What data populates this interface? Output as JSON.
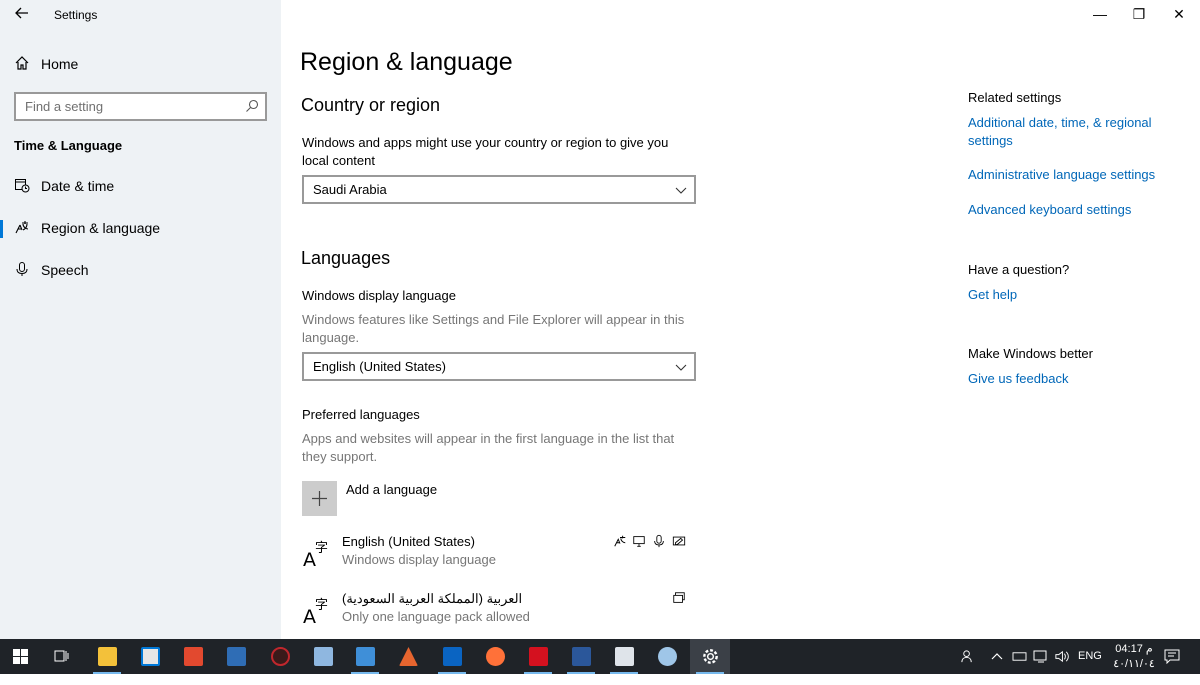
{
  "window": {
    "app_title": "Settings",
    "minimize": "—",
    "restore": "❐",
    "close": "✕"
  },
  "sidebar": {
    "home": "Home",
    "search_placeholder": "Find a setting",
    "section": "Time & Language",
    "items": [
      {
        "label": "Date & time",
        "icon": "calendar-clock-icon"
      },
      {
        "label": "Region & language",
        "icon": "region-language-icon",
        "active": true
      },
      {
        "label": "Speech",
        "icon": "microphone-icon"
      }
    ]
  },
  "main": {
    "title": "Region & language",
    "country": {
      "heading": "Country or region",
      "description": "Windows and apps might use your country or region to give you local content",
      "value": "Saudi Arabia"
    },
    "languages": {
      "heading": "Languages",
      "display_label": "Windows display language",
      "display_description": "Windows features like Settings and File Explorer will appear in this language.",
      "display_value": "English (United States)",
      "preferred_label": "Preferred languages",
      "preferred_description": "Apps and websites will appear in the first language in the list that they support.",
      "add_label": "Add a language",
      "list": [
        {
          "name": "English (United States)",
          "sub": "Windows display language"
        },
        {
          "name": "العربية (المملكة العربية السعودية)",
          "sub": "Only one language pack allowed"
        }
      ]
    }
  },
  "related": {
    "heading": "Related settings",
    "links": [
      "Additional date, time, & regional settings",
      "Administrative language settings",
      "Advanced keyboard settings"
    ],
    "question_heading": "Have a question?",
    "help_link": "Get help",
    "better_heading": "Make Windows better",
    "feedback_link": "Give us feedback"
  },
  "taskbar": {
    "lang": "ENG",
    "time": "04:17 م",
    "date": "٤٠/١١/٠٤",
    "accent": "#76b9ed"
  }
}
